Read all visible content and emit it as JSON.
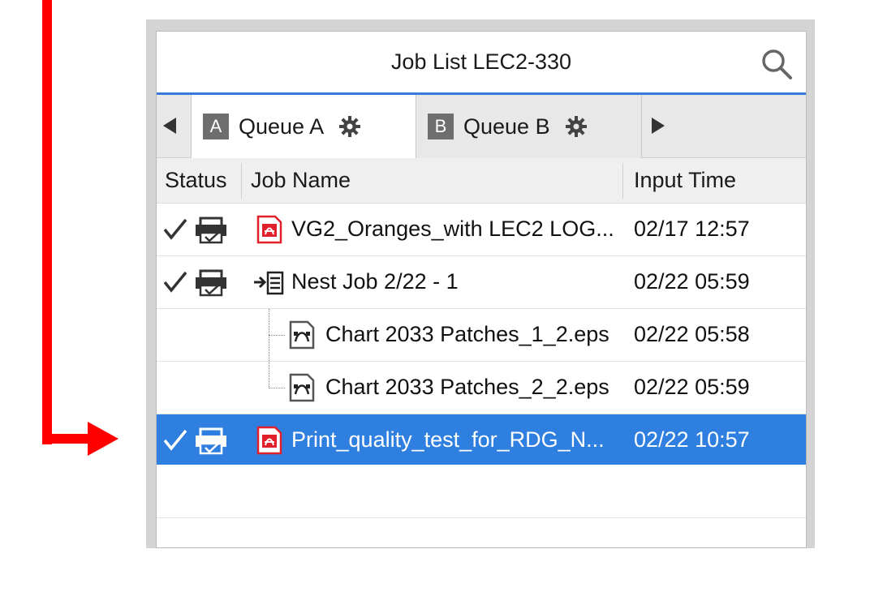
{
  "window": {
    "title": "Job List LEC2-330",
    "search_icon": "search-icon"
  },
  "tabs": [
    {
      "letter": "A",
      "label": "Queue A",
      "active": true
    },
    {
      "letter": "B",
      "label": "Queue B",
      "active": false
    }
  ],
  "columns": {
    "status": "Status",
    "job_name": "Job Name",
    "input_time": "Input Time"
  },
  "rows": [
    {
      "status": "done",
      "icon": "pdf-file-icon",
      "name": "VG2_Oranges_with LEC2 LOG...",
      "time": "02/17 12:57",
      "level": 0
    },
    {
      "status": "done",
      "icon": "nest-job-icon",
      "name": "Nest Job 2/22 - 1",
      "time": "02/22 05:59",
      "level": 0
    },
    {
      "status": "",
      "icon": "eps-file-icon",
      "name": "Chart 2033 Patches_1_2.eps",
      "time": "02/22 05:58",
      "level": 1
    },
    {
      "status": "",
      "icon": "eps-file-icon",
      "name": "Chart 2033 Patches_2_2.eps",
      "time": "02/22 05:59",
      "level": 1
    },
    {
      "status": "done",
      "icon": "pdf-file-icon",
      "name": "Print_quality_test_for_RDG_N...",
      "time": "02/22 10:57",
      "level": 0,
      "selected": true
    }
  ],
  "colors": {
    "accent": "#3b78d8",
    "selection": "#2f7fe0",
    "annotation_arrow": "#ff0000",
    "pdf_red": "#e0202a"
  }
}
